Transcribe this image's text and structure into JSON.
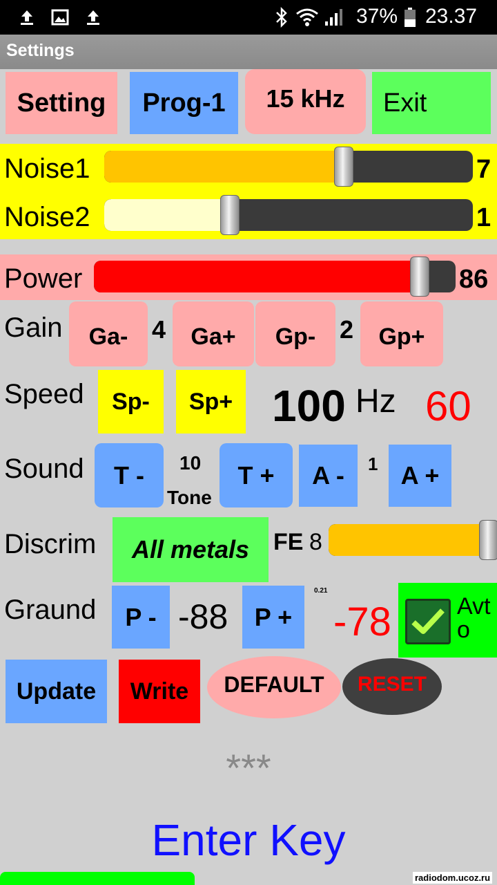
{
  "status": {
    "battery": "37%",
    "time": "23.37"
  },
  "app": {
    "title": "Settings"
  },
  "top_buttons": {
    "setting": "Setting",
    "prog": "Prog-1",
    "freq": "15 kHz",
    "exit": "Exit"
  },
  "noise1": {
    "label": "Noise1",
    "value": "7",
    "level": 0.65
  },
  "noise2": {
    "label": "Noise2",
    "value": "1",
    "level": 0.34
  },
  "power": {
    "label": "Power",
    "value": "86",
    "level": 0.9
  },
  "gain": {
    "label": "Gain",
    "ga_minus": "Ga-",
    "ga_value": "4",
    "ga_plus": "Ga+",
    "gp_minus": "Gp-",
    "gp_value": "2",
    "gp_plus": "Gp+"
  },
  "speed": {
    "label": "Speed",
    "minus": "Sp-",
    "plus": "Sp+",
    "value": "100",
    "unit": "Hz",
    "red_value": "60"
  },
  "sound": {
    "label": "Sound",
    "t_minus": "T -",
    "tone_value": "10",
    "tone_label": "Tone",
    "t_plus": "T +",
    "a_minus": "A -",
    "a_value": "1",
    "a_plus": "A +"
  },
  "discrim": {
    "label": "Discrim",
    "mode": "All metals",
    "fe_label": "FE",
    "fe_value": "8",
    "level": 0.95
  },
  "ground": {
    "label": "Graund",
    "p_minus": "P -",
    "value": "-88",
    "p_plus": "P +",
    "small": "0.21",
    "red_value": "-78",
    "auto_label": "Avt o",
    "auto_checked": true
  },
  "actions": {
    "update": "Update",
    "write": "Write",
    "default": "DEFAULT",
    "reset": "RESET"
  },
  "key": {
    "mask": "***",
    "prompt": "Enter Key"
  },
  "watermark": "radiodom.ucoz.ru",
  "colors": {
    "pink": "#ffaaaa",
    "blue": "#6aa6ff",
    "green": "#5cff5c",
    "yellow": "#ffff00",
    "red": "#ff0000",
    "orange_fill": "#ffc400",
    "enter_key_blue": "#1010ff"
  }
}
